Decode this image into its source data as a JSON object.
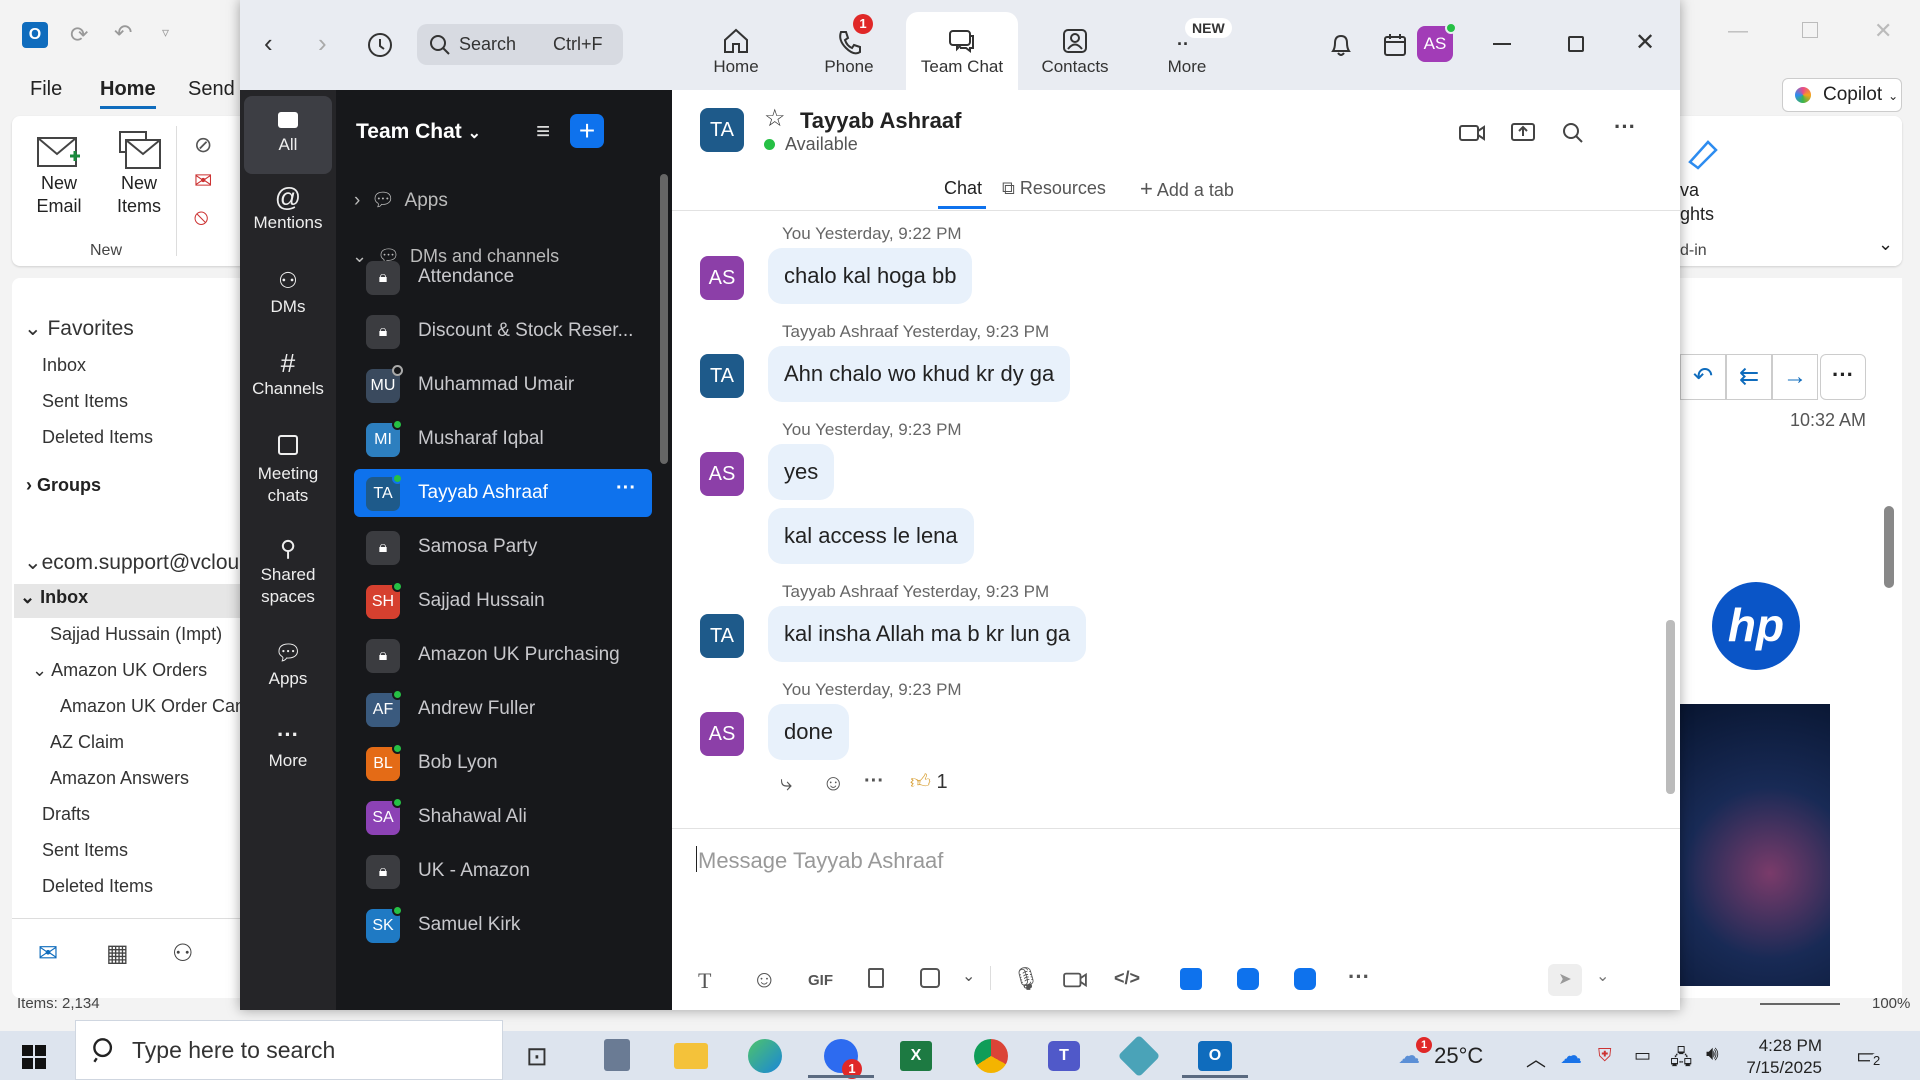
{
  "outlook": {
    "ribbon_tabs": [
      "File",
      "Home",
      "Send /"
    ],
    "new_email": "New\nEmail",
    "new_items": "New\nItems",
    "group_new": "New",
    "copilot": "Copilot",
    "right_partial_1": "va",
    "right_partial_2": "ghts",
    "right_partial_3": "d-in",
    "favorites": "Favorites",
    "fav_items": [
      "Inbox",
      "Sent Items",
      "Deleted Items"
    ],
    "groups": "Groups",
    "account": "ecom.support@vclou",
    "inbox": "Inbox",
    "folders": [
      "Sajjad Hussain (Impt)",
      "Amazon UK Orders",
      "Amazon UK Order Can",
      "AZ Claim",
      "Amazon Answers",
      "Drafts",
      "Sent Items",
      "Deleted Items"
    ],
    "time": "10:32 AM",
    "items_count": "Items: 2,134",
    "zoom_pct": "100%"
  },
  "zoom": {
    "search_placeholder": "Search",
    "search_shortcut": "Ctrl+F",
    "nav": [
      {
        "label": "Home",
        "badge": ""
      },
      {
        "label": "Phone",
        "badge": "1"
      },
      {
        "label": "Team Chat",
        "badge": ""
      },
      {
        "label": "Contacts",
        "badge": ""
      },
      {
        "label": "More",
        "badge": "NEW"
      }
    ],
    "avatar": "AS",
    "rail": [
      "All",
      "Mentions",
      "DMs",
      "Channels",
      "Meeting\nchats",
      "Shared\nspaces",
      "Apps",
      "More"
    ],
    "list_title": "Team Chat",
    "section_apps": "Apps",
    "section_dms": "DMs and channels",
    "list": [
      {
        "initials": "",
        "name": "Attendance",
        "color": "#3b3c40",
        "status": "lock"
      },
      {
        "initials": "",
        "name": "Discount & Stock Reser...",
        "color": "#3b3c40",
        "status": "lock"
      },
      {
        "initials": "MU",
        "name": "Muhammad Umair",
        "color": "#3a4a5e",
        "status": "away"
      },
      {
        "initials": "MI",
        "name": "Musharaf Iqbal",
        "color": "#2d7fbf",
        "status": "online"
      },
      {
        "initials": "TA",
        "name": "Tayyab Ashraaf",
        "color": "#1e5a8a",
        "status": "online"
      },
      {
        "initials": "",
        "name": "Samosa Party",
        "color": "#3b3c40",
        "status": "lock"
      },
      {
        "initials": "SH",
        "name": "Sajjad Hussain",
        "color": "#d6402f",
        "status": "online"
      },
      {
        "initials": "",
        "name": "Amazon UK Purchasing",
        "color": "#3b3c40",
        "status": "lock"
      },
      {
        "initials": "AF",
        "name": "Andrew Fuller",
        "color": "#3a5a7e",
        "status": "online"
      },
      {
        "initials": "BL",
        "name": "Bob Lyon",
        "color": "#e46b16",
        "status": "online"
      },
      {
        "initials": "SA",
        "name": "Shahawal Ali",
        "color": "#8c42b5",
        "status": "online"
      },
      {
        "initials": "",
        "name": "UK - Amazon",
        "color": "#3b3c40",
        "status": "lock"
      },
      {
        "initials": "SK",
        "name": "Samuel Kirk",
        "color": "#1f7ac4",
        "status": "online"
      }
    ],
    "chat": {
      "contact_initials": "TA",
      "contact_name": "Tayyab Ashraaf",
      "status": "Available",
      "tabs": [
        "Chat",
        "Resources",
        "Add a tab"
      ],
      "messages": [
        {
          "who": "You",
          "time": "Yesterday, 9:22 PM",
          "av": "AS",
          "texts": [
            "chalo kal hoga bb"
          ]
        },
        {
          "who": "Tayyab Ashraaf",
          "time": "Yesterday, 9:23 PM",
          "av": "TA",
          "texts": [
            "Ahn chalo wo khud kr dy ga"
          ]
        },
        {
          "who": "You",
          "time": "Yesterday, 9:23 PM",
          "av": "AS",
          "texts": [
            "yes",
            "kal access le lena"
          ]
        },
        {
          "who": "Tayyab Ashraaf",
          "time": "Yesterday, 9:23 PM",
          "av": "TA",
          "texts": [
            "kal insha Allah ma b kr lun ga"
          ]
        },
        {
          "who": "You",
          "time": "Yesterday, 9:23 PM",
          "av": "AS",
          "texts": [
            "done"
          ]
        }
      ],
      "reaction_count": "1",
      "composer_placeholder": "Message Tayyab Ashraaf",
      "gif": "GIF"
    }
  },
  "taskbar": {
    "search_placeholder": "Type here to search",
    "weather": "25°C",
    "time": "4:28 PM",
    "date": "7/15/2025",
    "notif_count": "2",
    "zoom_badge": "1",
    "weather_badge": "1"
  },
  "colors": {
    "zoom_blue": "#0e72ed",
    "outlook_blue": "#0f6cbd",
    "rail_bg": "#252528",
    "list_bg": "#17181b"
  }
}
